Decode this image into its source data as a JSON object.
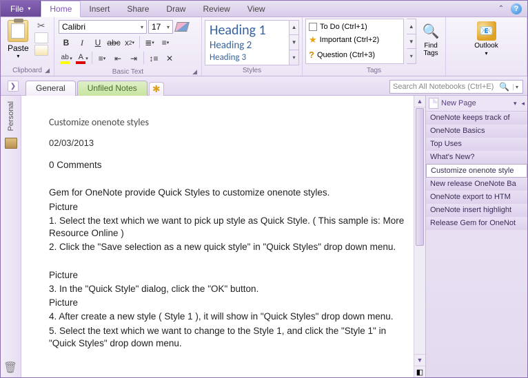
{
  "tabs": {
    "file": "File",
    "list": [
      "Home",
      "Insert",
      "Share",
      "Draw",
      "Review",
      "View"
    ],
    "active": "Home"
  },
  "ribbon": {
    "clipboard": {
      "label": "Clipboard",
      "paste": "Paste"
    },
    "basictext": {
      "label": "Basic Text",
      "font": "Calibri",
      "size": "17"
    },
    "styles": {
      "label": "Styles",
      "h1": "Heading 1",
      "h2": "Heading 2",
      "h3": "Heading 3"
    },
    "tags": {
      "label": "Tags",
      "items": [
        {
          "icon": "check",
          "label": "To Do (Ctrl+1)"
        },
        {
          "icon": "star",
          "label": "Important (Ctrl+2)"
        },
        {
          "icon": "q",
          "label": "Question (Ctrl+3)"
        }
      ],
      "find": "Find Tags"
    },
    "outlook": {
      "label": "Outlook"
    }
  },
  "sections": {
    "active": "General",
    "other": "Unfiled Notes",
    "search_placeholder": "Search All Notebooks (Ctrl+E)"
  },
  "leftrail": {
    "notebook": "Personal"
  },
  "note": {
    "title": "Customize onenote styles",
    "date": "02/03/2013",
    "comments": "0 Comments",
    "lines": [
      "Gem for OneNote provide Quick Styles to customize onenote styles.",
      "Picture",
      "1. Select the text which we want to pick up style as Quick Style. ( This sample is: More Resource Online )",
      "2. Click the \"Save selection as a new quick style\" in \"Quick Styles\" drop down menu.",
      "",
      "Picture",
      "3. In the \"Quick Style\" dialog, click the \"OK\" button.",
      "Picture",
      "4. After create a new style ( Style 1 ), it will show in \"Quick Styles\" drop down menu.",
      "5. Select the text which we want to change to the Style 1, and click the \"Style 1\"  in \"Quick Styles\" drop down menu."
    ]
  },
  "pages": {
    "newpage": "New Page",
    "list": [
      "OneNote keeps track of",
      "OneNote Basics",
      "Top Uses",
      "What's New?",
      "Customize onenote style",
      "New release OneNote Ba",
      "OneNote export to HTM",
      "OneNote insert highlight",
      "Release Gem for OneNot"
    ],
    "selected_index": 4
  }
}
